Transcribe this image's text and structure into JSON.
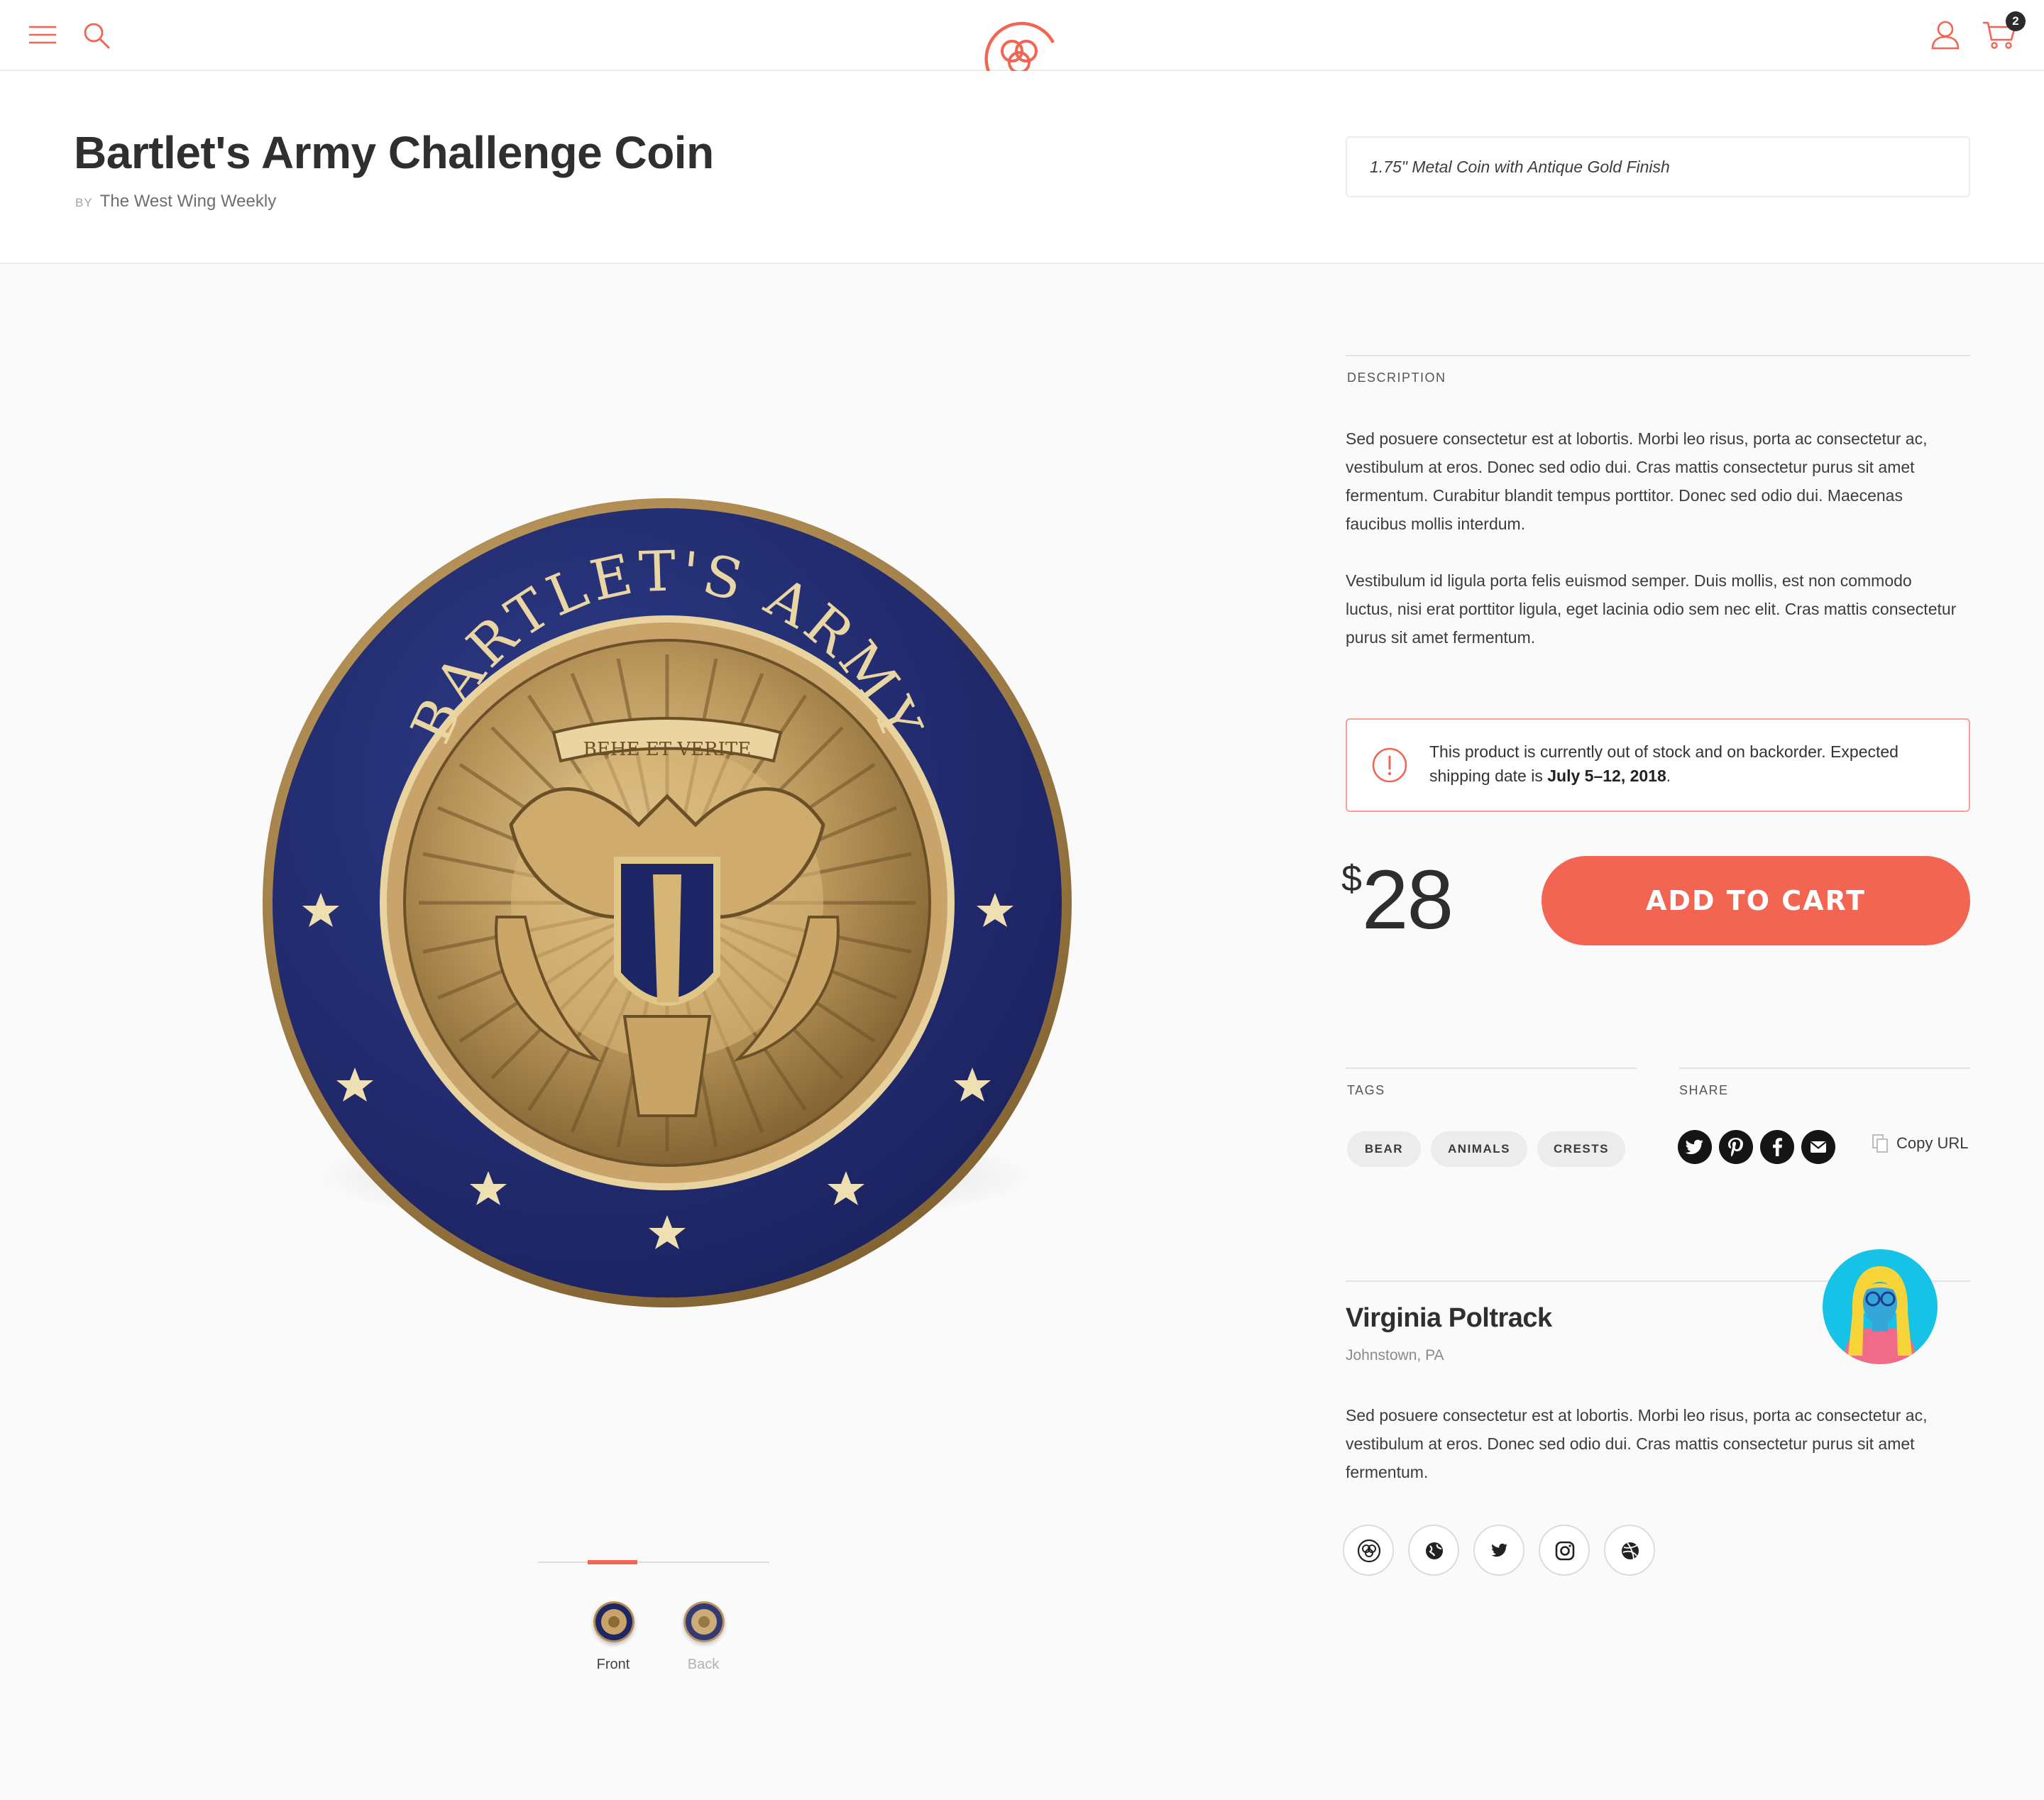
{
  "nav": {
    "cart_count": "2",
    "brand_color": "#f26552"
  },
  "product": {
    "title": "Bartlet's Army Challenge Coin",
    "by_label": "BY",
    "author": "The West Wing Weekly",
    "variant": "1.75\" Metal Coin with Antique Gold Finish",
    "coin_text": "BARTLET'S ARMY",
    "motto": "ВЕНЕ ЕТ VERITE"
  },
  "gallery": {
    "views": [
      {
        "label": "Front",
        "active": true
      },
      {
        "label": "Back",
        "active": false
      }
    ]
  },
  "description": {
    "label": "DESCRIPTION",
    "paragraphs": [
      "Sed posuere consectetur est at lobortis. Morbi leo risus, porta ac consectetur ac, vestibulum at eros. Donec sed odio dui. Cras mattis consectetur purus sit amet fermentum. Curabitur blandit tempus porttitor. Donec sed odio dui. Maecenas faucibus mollis interdum.",
      "Vestibulum id ligula porta felis euismod semper. Duis mollis, est non commodo luctus, nisi erat porttitor ligula, eget lacinia odio sem nec elit. Cras mattis consectetur purus sit amet fermentum."
    ]
  },
  "stock_alert": {
    "text_before": "This product is currently out of stock and on backorder. Expected shipping date is ",
    "date": "July 5–12, 2018",
    "text_after": "."
  },
  "purchase": {
    "currency": "$",
    "price": "28",
    "button_label": "ADD TO CART"
  },
  "tags": {
    "label": "TAGS",
    "items": [
      "BEAR",
      "ANIMALS",
      "CRESTS"
    ]
  },
  "share": {
    "label": "SHARE",
    "icons": [
      "twitter-icon",
      "pinterest-icon",
      "facebook-icon",
      "email-icon"
    ],
    "copy_label": "Copy URL"
  },
  "maker": {
    "name": "Virginia Poltrack",
    "location": "Johnstown, PA",
    "bio": "Sed posuere consectetur est at lobortis. Morbi leo risus, porta ac consectetur ac, vestibulum at eros. Donec sed odio dui. Cras mattis consectetur purus sit amet fermentum.",
    "links": [
      "shop-icon",
      "globe-icon",
      "twitter-icon",
      "instagram-icon",
      "dribbble-icon"
    ]
  }
}
